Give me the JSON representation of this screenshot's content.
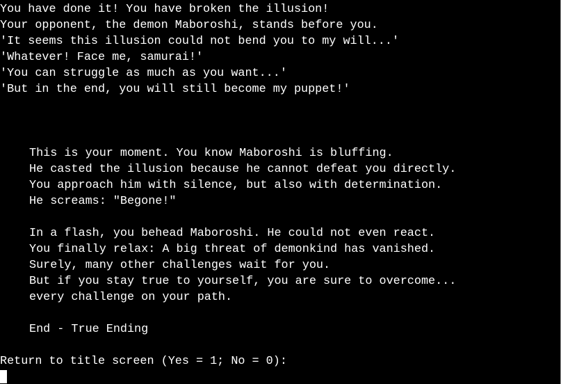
{
  "intro": {
    "lines": [
      "You have done it! You have broken the illusion!",
      "Your opponent, the demon Maboroshi, stands before you.",
      "'It seems this illusion could not bend you to my will...'",
      "'Whatever! Face me, samurai!'",
      "'You can struggle as much as you want...'",
      "'But in the end, you will still become my puppet!'"
    ]
  },
  "story": {
    "paragraph1": [
      "This is your moment. You know Maboroshi is bluffing.",
      "He casted the illusion because he cannot defeat you directly.",
      "You approach him with silence, but also with determination.",
      "He screams: \"Begone!\""
    ],
    "paragraph2": [
      "In a flash, you behead Maboroshi. He could not even react.",
      "You finally relax: A big threat of demonkind has vanished.",
      "Surely, many other challenges wait for you.",
      "But if you stay true to yourself, you are sure to overcome...",
      "every challenge on your path."
    ],
    "ending": "End - True Ending"
  },
  "prompt": {
    "text": "Return to title screen (Yes = 1; No = 0):"
  },
  "colors": {
    "background": "#000000",
    "text": "#ffffff"
  }
}
